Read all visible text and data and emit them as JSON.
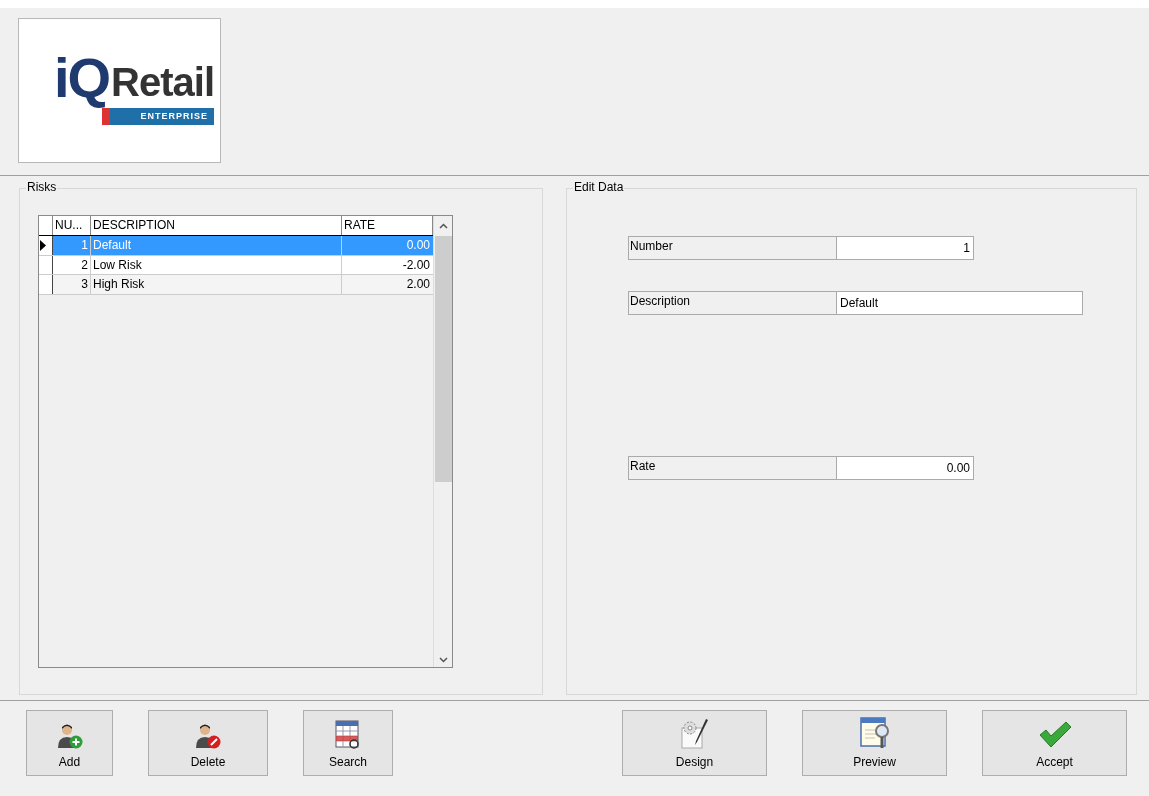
{
  "logo": {
    "letter_i": "i",
    "letter_q": "Q",
    "word": "Retail",
    "tagline": "ENTERPRISE"
  },
  "risks": {
    "title": "Risks",
    "columns": [
      "NU...",
      "DESCRIPTION",
      "RATE"
    ],
    "rows": [
      {
        "number": "1",
        "description": "Default",
        "rate": "0.00",
        "selected": true
      },
      {
        "number": "2",
        "description": "Low Risk",
        "rate": "-2.00",
        "selected": false
      },
      {
        "number": "3",
        "description": "High Risk",
        "rate": "2.00",
        "selected": false
      }
    ]
  },
  "edit_data": {
    "title": "Edit Data",
    "fields": [
      {
        "kind": "short",
        "label": "Number",
        "value": "1"
      },
      {
        "kind": "wide",
        "label": "Description",
        "value": "Default"
      },
      {
        "kind": "spaced",
        "label": "Rate",
        "value": "0.00"
      }
    ]
  },
  "buttons_left": [
    {
      "kind": "add",
      "label": "Add"
    },
    {
      "kind": "delete",
      "label": "Delete"
    },
    {
      "kind": "search",
      "label": "Search"
    }
  ],
  "buttons_right": [
    {
      "kind": "design",
      "label": "Design"
    },
    {
      "kind": "preview",
      "label": "Preview"
    },
    {
      "kind": "accept",
      "label": "Accept"
    }
  ]
}
